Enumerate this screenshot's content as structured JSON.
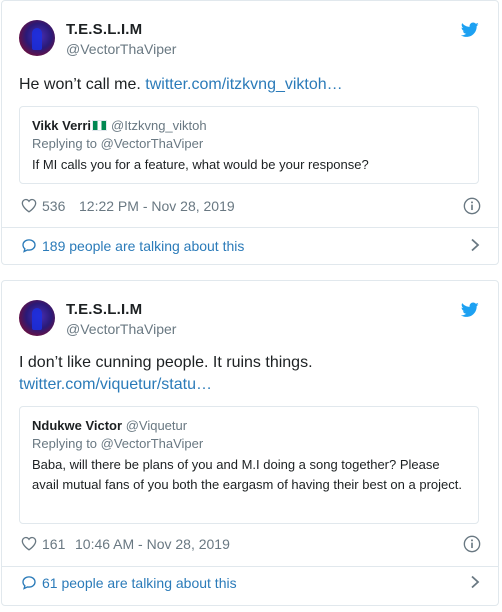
{
  "tweets": [
    {
      "author_name": "T.E.S.L.I.M",
      "author_handle": "@VectorThaViper",
      "text": "He won’t call me. ",
      "link": "twitter.com/itzkvng_viktoh…",
      "quote": {
        "name": "Vikk Verri",
        "handle": "@Itzkvng_viktoh",
        "replying": "Replying to @VectorThaViper",
        "text": "If MI calls you for a feature, what would be your response?"
      },
      "likes": "536",
      "timestamp": "12:22 PM - Nov 28, 2019",
      "talking": "189 people are talking about this"
    },
    {
      "author_name": "T.E.S.L.I.M",
      "author_handle": "@VectorThaViper",
      "text": "I don’t like cunning people. It ruins things.",
      "link": "twitter.com/viquetur/statu…",
      "quote": {
        "name": "Ndukwe Victor",
        "handle": "@Viquetur",
        "replying": "Replying to @VectorThaViper",
        "text": "Baba, will there be plans of you and M.I doing a song together? Please avail mutual fans of you both the eargasm of having their best on a project."
      },
      "likes": "161",
      "timestamp": "10:46 AM - Nov 28, 2019",
      "talking": "61 people are talking about this"
    }
  ],
  "icons": {
    "brand": "twitter-bird-icon",
    "like": "heart-icon",
    "info": "info-icon",
    "conversation": "speech-bubble-icon",
    "more": "chevron-right-icon"
  },
  "colors": {
    "link": "#2b7bb9",
    "twitter_blue": "#1da1f2",
    "muted": "#697882",
    "border": "#e1e8ed"
  }
}
